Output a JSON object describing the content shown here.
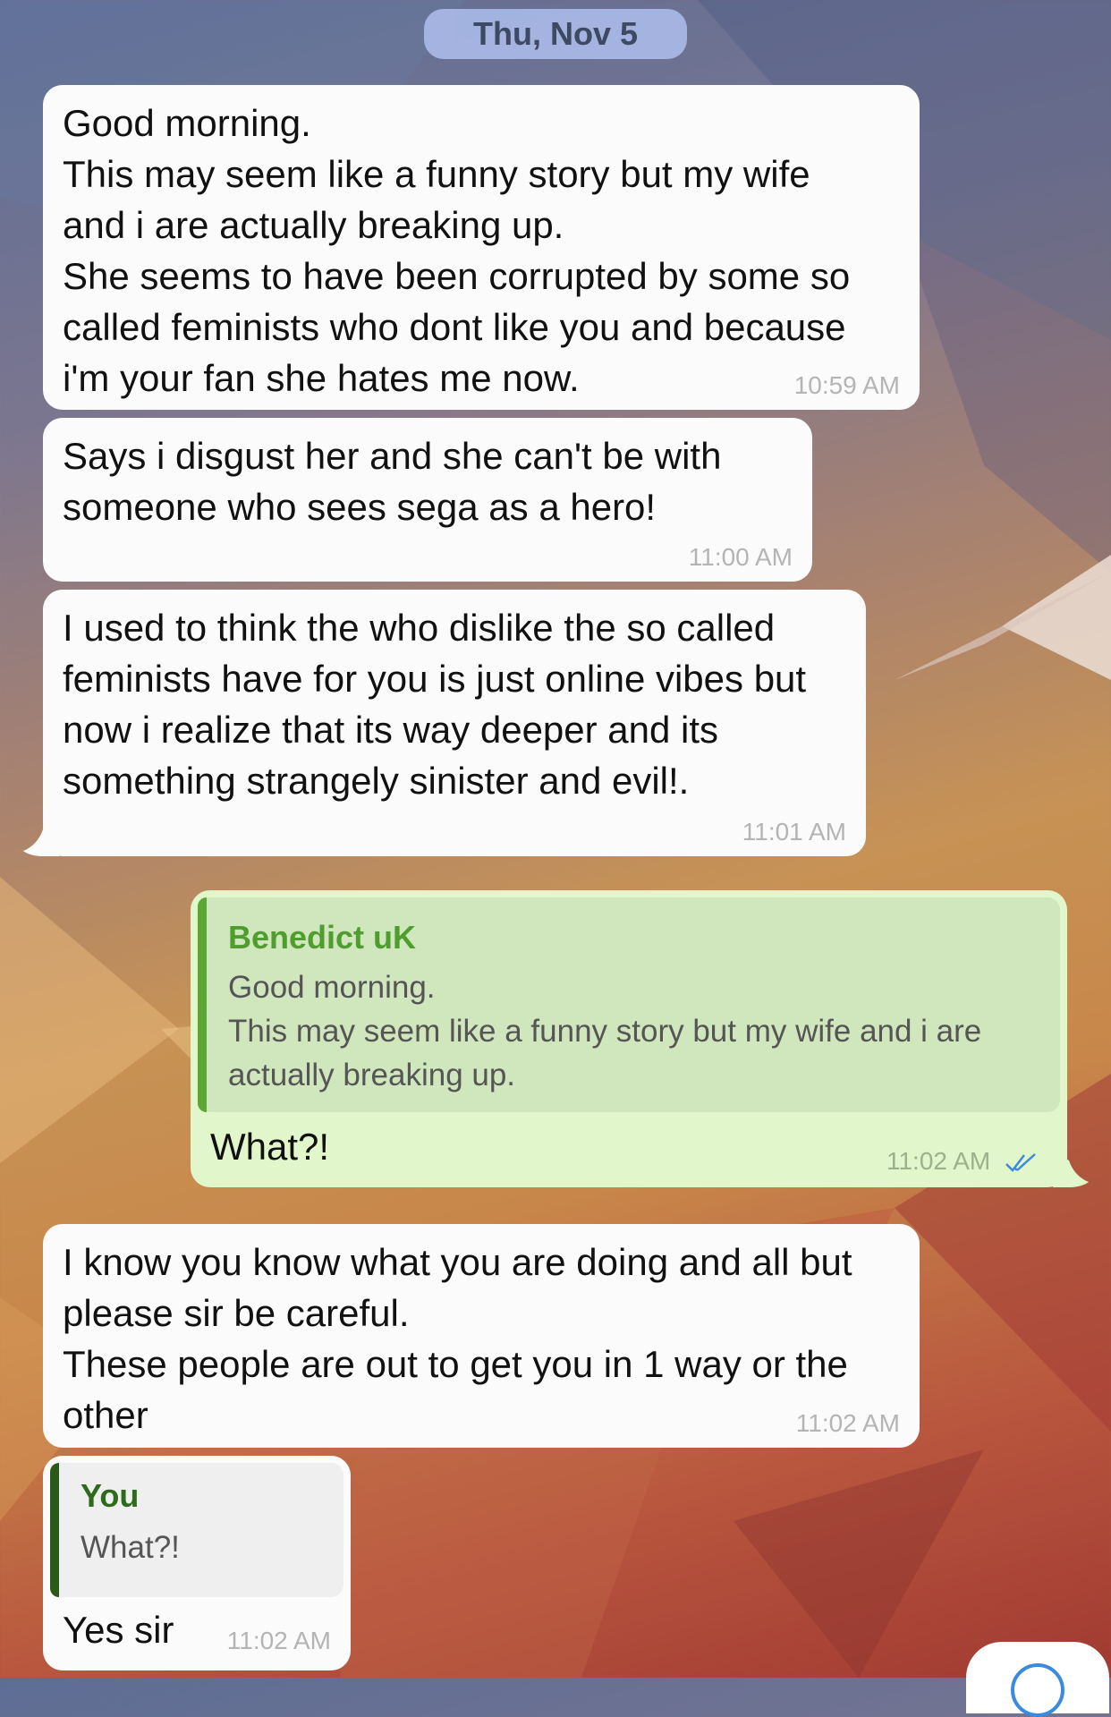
{
  "date_label": "Thu, Nov 5",
  "messages": [
    {
      "text": "Good morning.\nThis may seem like a funny story but my wife\nand i are actually breaking up.\nShe seems to have been corrupted by some so\ncalled feminists who dont like you and because\ni'm your fan she hates me now.",
      "time": "10:59 AM"
    },
    {
      "text": "Says i disgust her and she can't be with\nsomeone who sees sega as a hero!",
      "time": "11:00 AM"
    },
    {
      "text": "I used to think the who dislike the so called\nfeminists have for you is just online vibes but\nnow i realize that its way deeper and its\nsomething strangely sinister and evil!.",
      "time": "11:01 AM"
    },
    {
      "reply_name": "Benedict uK",
      "reply_text": "Good morning.\nThis may seem like a funny story but my wife and i are\nactually breaking up.",
      "text": "What?!",
      "time": "11:02 AM"
    },
    {
      "text": "I know you know what you are doing and all but\nplease sir be careful.\nThese people are out to get you in 1 way or the\nother",
      "time": "11:02 AM"
    },
    {
      "reply_name": "You",
      "reply_text": "What?!",
      "text": "Yes sir",
      "time": "11:02 AM"
    }
  ],
  "colors": {
    "incoming_bubble": "#fbfbfb",
    "outgoing_bubble": "#e1f7cb",
    "outgoing_quote_accent": "#5aa833",
    "incoming_quote_accent": "#2a5a1a",
    "read_ticks": "#3a8be0"
  },
  "icons": [
    "double-check-icon",
    "scroll-down-icon"
  ]
}
